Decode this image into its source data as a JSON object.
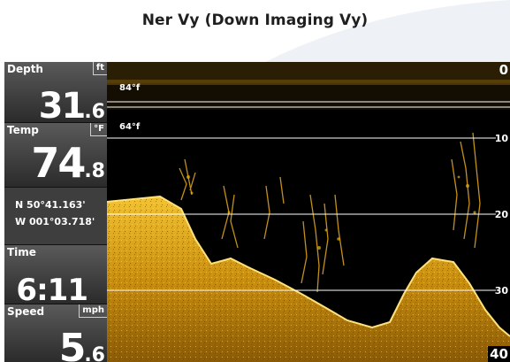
{
  "title": "Ner Vy (Down Imaging Vy)",
  "panel": {
    "depth": {
      "label": "Depth",
      "unit": "ft",
      "int": "31",
      "dec": ".6"
    },
    "temp": {
      "label": "Temp",
      "unit": "°F",
      "int": "74",
      "dec": ".8"
    },
    "position": {
      "lat": "N 50°41.163'",
      "lon": "W 001°03.718'"
    },
    "time": {
      "label": "Time",
      "value": "6:11"
    },
    "speed": {
      "label": "Speed",
      "unit": "mph",
      "int": "5",
      "dec": ".6"
    }
  },
  "sonar": {
    "temp_tags": [
      "84°f",
      "64°f"
    ],
    "depth_scale": [
      "0",
      "10",
      "20",
      "30",
      "40"
    ]
  },
  "colors": {
    "sonar_gold": "#e8b11a",
    "sonar_bg": "#000000",
    "panel_bg": "#3a3a3a"
  }
}
